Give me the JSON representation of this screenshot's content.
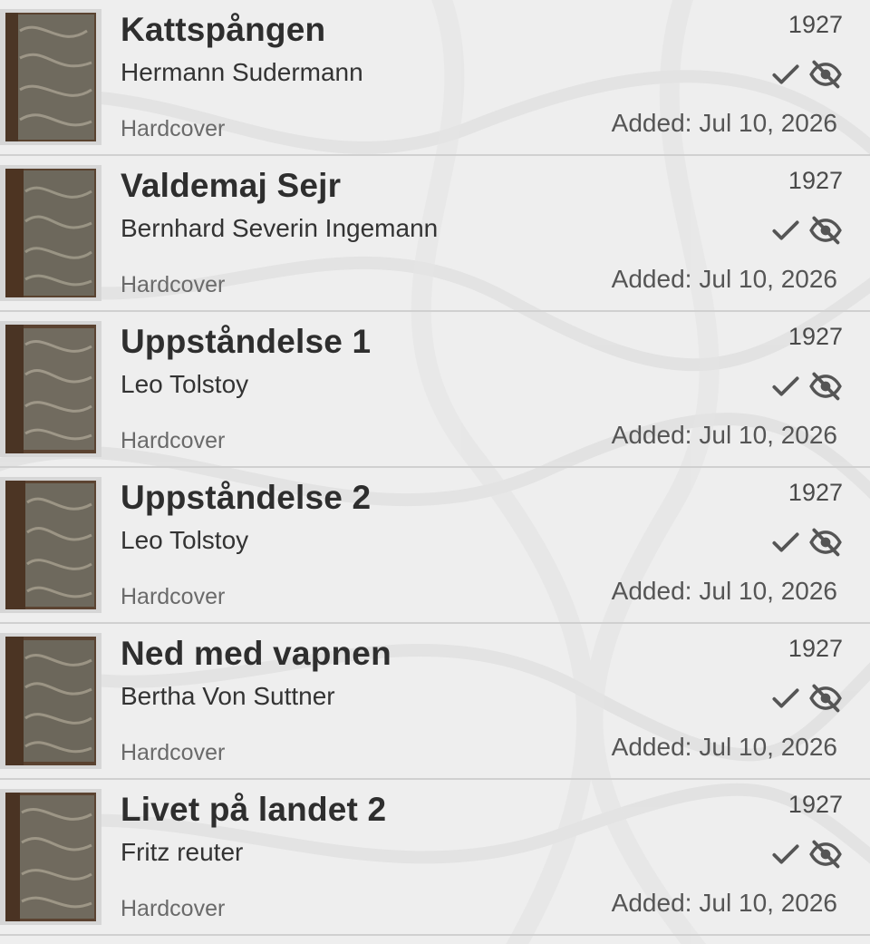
{
  "colors": {
    "background": "#ececec",
    "title": "#2e2e2e",
    "text": "#333333",
    "muted": "#6a6a6a",
    "icon": "#555555",
    "divider": "#d0d0d0"
  },
  "books": [
    {
      "title": "Kattspången",
      "author": "Hermann Sudermann",
      "format": "Hardcover",
      "year": "1927",
      "added_label": "Added:",
      "added_date": "Jul 10, 2026",
      "icons": [
        "check-icon",
        "eye-off-icon"
      ]
    },
    {
      "title": "Valdemaj Sejr",
      "author": "Bernhard Severin Ingemann",
      "format": "Hardcover",
      "year": "1927",
      "added_label": "Added:",
      "added_date": "Jul 10, 2026",
      "icons": [
        "check-icon",
        "eye-off-icon"
      ]
    },
    {
      "title": "Uppståndelse 1",
      "author": "Leo Tolstoy",
      "format": "Hardcover",
      "year": "1927",
      "added_label": "Added:",
      "added_date": "Jul 10, 2026",
      "icons": [
        "check-icon",
        "eye-off-icon"
      ]
    },
    {
      "title": "Uppståndelse 2",
      "author": "Leo Tolstoy",
      "format": "Hardcover",
      "year": "1927",
      "added_label": "Added:",
      "added_date": "Jul 10, 2026",
      "icons": [
        "check-icon",
        "eye-off-icon"
      ]
    },
    {
      "title": "Ned med vapnen",
      "author": "Bertha Von Suttner",
      "format": "Hardcover",
      "year": "1927",
      "added_label": "Added:",
      "added_date": "Jul 10, 2026",
      "icons": [
        "check-icon",
        "eye-off-icon"
      ]
    },
    {
      "title": "Livet på landet 2",
      "author": "Fritz reuter",
      "format": "Hardcover",
      "year": "1927",
      "added_label": "Added:",
      "added_date": "Jul 10, 2026",
      "icons": [
        "check-icon",
        "eye-off-icon"
      ]
    }
  ]
}
